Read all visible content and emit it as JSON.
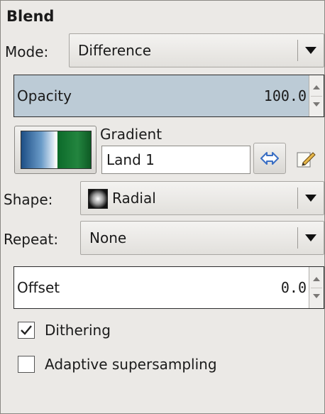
{
  "panel": {
    "title": "Blend"
  },
  "mode": {
    "label": "Mode:",
    "value": "Difference",
    "icon": "chevron-down-icon"
  },
  "opacity": {
    "label": "Opacity",
    "value": "100.0",
    "fill_percent": 100
  },
  "gradient": {
    "label": "Gradient",
    "name": "Land 1",
    "reverse_icon": "swap-arrows-icon",
    "edit_icon": "pencil-edit-icon",
    "colors": [
      "#1d4e85",
      "#6a9bc8",
      "#0c6a2a",
      "#23853f"
    ]
  },
  "shape": {
    "label": "Shape:",
    "value": "Radial",
    "icon": "radial-shape-icon"
  },
  "repeat": {
    "label": "Repeat:",
    "value": "None"
  },
  "offset": {
    "label": "Offset",
    "value": "0.0"
  },
  "options": {
    "dithering": {
      "label": "Dithering",
      "checked": true
    },
    "adaptive": {
      "label": "Adaptive supersampling",
      "checked": false
    }
  },
  "colors": {
    "opacity_fill": "#bccbd6",
    "panel_bg": "#ebe9e6",
    "swap_icon": "#3a6fc4"
  }
}
